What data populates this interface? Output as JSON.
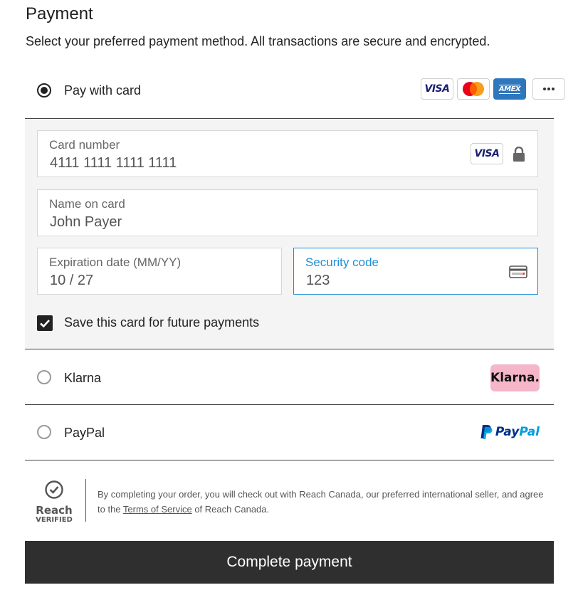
{
  "header": {
    "title": "Payment",
    "subtitle": "Select your preferred payment method. All transactions are secure and encrypted."
  },
  "payment_methods": {
    "card": {
      "label": "Pay with card",
      "selected": true,
      "logos": [
        "visa",
        "mastercard",
        "amex",
        "more"
      ]
    },
    "klarna": {
      "label": "Klarna",
      "selected": false,
      "badge": "Klarna."
    },
    "paypal": {
      "label": "PayPal",
      "selected": false,
      "logo_text_pay": "Pay",
      "logo_text_pal": "Pal"
    }
  },
  "card_form": {
    "card_number": {
      "label": "Card number",
      "value": "4111 1111 1111 1111",
      "brand": "VISA"
    },
    "name_on_card": {
      "label": "Name on card",
      "value": "John Payer"
    },
    "expiration": {
      "label": "Expiration date (MM/YY)",
      "value": "10 / 27"
    },
    "security_code": {
      "label": "Security code",
      "value": "123",
      "focused": true
    },
    "save_card": {
      "label": "Save this card for future payments",
      "checked": true
    }
  },
  "logos": {
    "visa": "VISA",
    "amex": "AMEX"
  },
  "footer": {
    "reach_logo_word": "Reach",
    "reach_logo_sub": "VERIFIED",
    "legal_prefix": "By completing your order, you will check out with Reach Canada, our preferred international seller, and agree to the ",
    "terms_link": "Terms of Service",
    "legal_suffix": " of Reach Canada."
  },
  "actions": {
    "complete_label": "Complete payment"
  },
  "colors": {
    "accent_focus": "#1f8fd2",
    "button_bg": "#2f2f2f",
    "klarna_pink": "#f5b6c9",
    "paypal_dark_blue": "#003087",
    "paypal_light_blue": "#009cde",
    "amex_blue": "#2e77bc",
    "visa_navy": "#1a1f71"
  }
}
